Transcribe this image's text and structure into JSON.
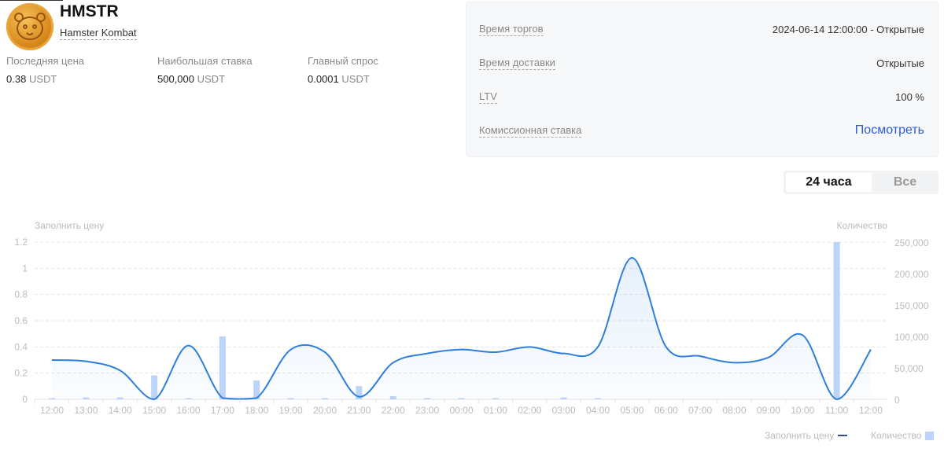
{
  "asset": {
    "symbol": "HMSTR",
    "name": "Hamster Kombat"
  },
  "stats": [
    {
      "label": "Последняя цена",
      "value": "0.38",
      "unit": "USDT"
    },
    {
      "label": "Наибольшая ставка",
      "value": "500,000",
      "unit": "USDT"
    },
    {
      "label": "Главный спрос",
      "value": "0.0001",
      "unit": "USDT"
    }
  ],
  "info": [
    {
      "key": "Время торгов",
      "value": "2024-06-14 12:00:00 - Открытые"
    },
    {
      "key": "Время доставки",
      "value": "Открытые"
    },
    {
      "key": "LTV",
      "value": "100 %"
    },
    {
      "key": "Комиссионная ставка",
      "value": "Посмотреть"
    }
  ],
  "range_toggle": {
    "options": [
      "24 часа",
      "Все"
    ],
    "selected": "24 часа"
  },
  "colors": {
    "line": "#2d7fdb",
    "bar": "#bcd4f7",
    "link": "#2a5bd7"
  },
  "chart_data": {
    "type": "line+bar",
    "left_axis_title": "Заполнить цену",
    "right_axis_title": "Количество",
    "categories": [
      "12:00",
      "13:00",
      "14:00",
      "15:00",
      "16:00",
      "17:00",
      "18:00",
      "19:00",
      "20:00",
      "21:00",
      "22:00",
      "23:00",
      "00:00",
      "01:00",
      "02:00",
      "03:00",
      "04:00",
      "05:00",
      "06:00",
      "07:00",
      "08:00",
      "09:00",
      "10:00",
      "11:00",
      "12:00"
    ],
    "left_ticks": [
      "0",
      "0.2",
      "0.4",
      "0.6",
      "0.8",
      "1",
      "1.2"
    ],
    "right_ticks": [
      "0",
      "50,000",
      "100,000",
      "150,000",
      "200,000",
      "250,000"
    ],
    "ylim_left": [
      0,
      1.2
    ],
    "ylim_right": [
      0,
      250000
    ],
    "grid": true,
    "legend_position": "bottom-right",
    "series": [
      {
        "name": "Заполнить цену",
        "type": "line",
        "axis": "left",
        "values": [
          0.3,
          0.29,
          0.22,
          0.0,
          0.41,
          0.01,
          0.01,
          0.38,
          0.36,
          0.02,
          0.28,
          0.35,
          0.38,
          0.36,
          0.4,
          0.35,
          0.4,
          1.08,
          0.4,
          0.33,
          0.28,
          0.32,
          0.49,
          0.0,
          0.38
        ]
      },
      {
        "name": "Количество",
        "type": "bar",
        "axis": "right",
        "values": [
          1000,
          3000,
          3000,
          38000,
          1000,
          100000,
          30000,
          500,
          2000,
          21000,
          5000,
          2000,
          2000,
          1000,
          0,
          3000,
          500,
          0,
          0,
          0,
          0,
          0,
          0,
          250000,
          0
        ]
      }
    ]
  }
}
